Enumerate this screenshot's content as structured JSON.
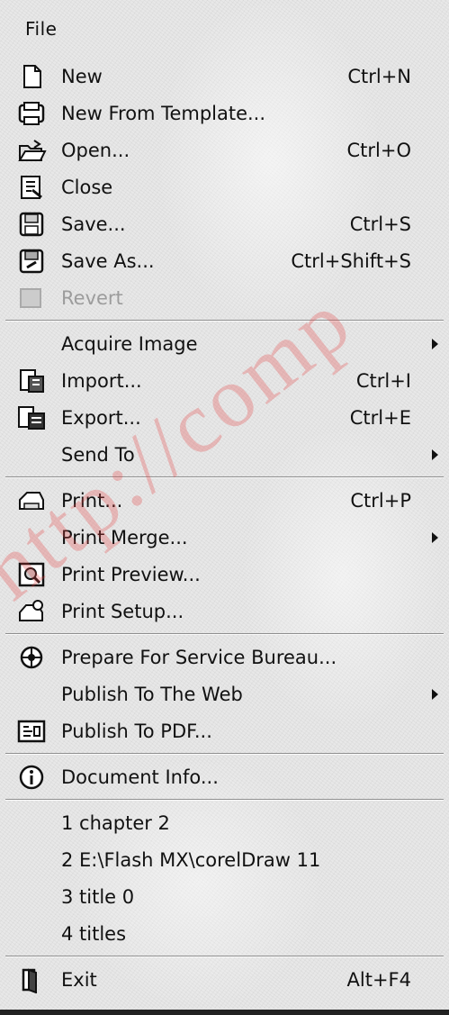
{
  "menu_title": "File",
  "items": [
    {
      "label": "New",
      "shortcut": "Ctrl+N",
      "icon": "new-document-icon"
    },
    {
      "label": "New From Template...",
      "shortcut": "",
      "icon": "template-icon"
    },
    {
      "label": "Open...",
      "shortcut": "Ctrl+O",
      "icon": "open-folder-icon"
    },
    {
      "label": "Close",
      "shortcut": "",
      "icon": "close-document-icon"
    },
    {
      "label": "Save...",
      "shortcut": "Ctrl+S",
      "icon": "save-icon"
    },
    {
      "label": "Save As...",
      "shortcut": "Ctrl+Shift+S",
      "icon": "save-as-icon"
    },
    {
      "label": "Revert",
      "shortcut": "",
      "icon": "revert-icon",
      "disabled": true
    },
    {
      "label": "Acquire Image",
      "shortcut": "",
      "submenu": true
    },
    {
      "label": "Import...",
      "shortcut": "Ctrl+I",
      "icon": "import-icon"
    },
    {
      "label": "Export...",
      "shortcut": "Ctrl+E",
      "icon": "export-icon"
    },
    {
      "label": "Send To",
      "shortcut": "",
      "submenu": true
    },
    {
      "label": "Print...",
      "shortcut": "Ctrl+P",
      "icon": "printer-icon"
    },
    {
      "label": "Print Merge...",
      "shortcut": "",
      "submenu": true
    },
    {
      "label": "Print Preview...",
      "shortcut": "",
      "icon": "print-preview-icon"
    },
    {
      "label": "Print Setup...",
      "shortcut": "",
      "icon": "print-setup-icon"
    },
    {
      "label": "Prepare For Service Bureau...",
      "shortcut": "",
      "icon": "service-bureau-icon"
    },
    {
      "label": "Publish To The Web",
      "shortcut": "",
      "submenu": true
    },
    {
      "label": "Publish To PDF...",
      "shortcut": "",
      "icon": "pdf-icon"
    },
    {
      "label": "Document Info...",
      "shortcut": "",
      "icon": "info-icon"
    },
    {
      "label": "1 chapter 2",
      "shortcut": ""
    },
    {
      "label": "2 E:\\Flash MX\\corelDraw 11",
      "shortcut": ""
    },
    {
      "label": "3 title 0",
      "shortcut": ""
    },
    {
      "label": "4 titles",
      "shortcut": ""
    },
    {
      "label": "Exit",
      "shortcut": "Alt+F4",
      "icon": "exit-icon"
    }
  ],
  "watermark_text": "http://comp"
}
